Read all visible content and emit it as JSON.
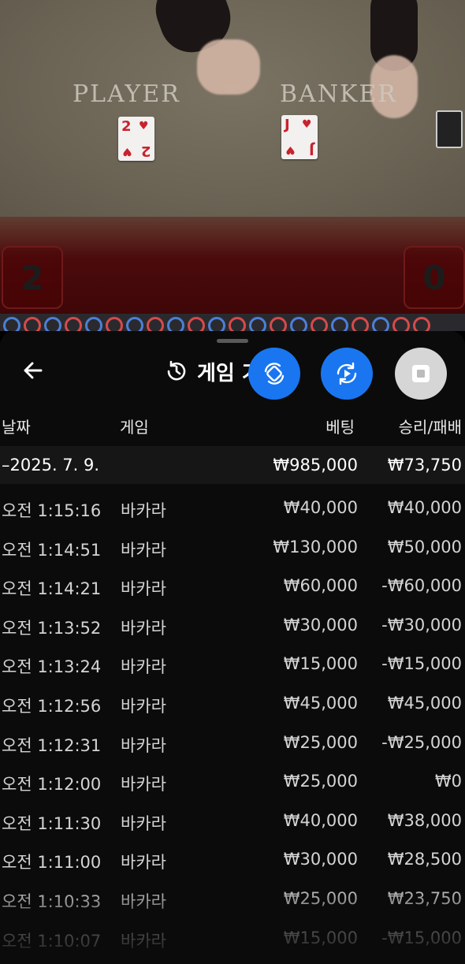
{
  "video": {
    "player_label": "PLAYER",
    "banker_label": "BANKER",
    "player_card": {
      "rank": "2",
      "suit": "♥"
    },
    "banker_card": {
      "rank": "J",
      "suit": "♥"
    },
    "player_score": "2",
    "banker_score": "0",
    "road": [
      "blue",
      "red",
      "blue",
      "red",
      "blue",
      "red",
      "blue",
      "red",
      "blue",
      "red",
      "blue",
      "red",
      "blue",
      "red",
      "blue",
      "red",
      "blue",
      "red",
      "blue",
      "red",
      "red"
    ]
  },
  "header": {
    "back_icon": "arrow-left-icon",
    "history_icon": "history-icon",
    "title": "게임 기록",
    "fab_swap_icon": "swap-icon",
    "fab_replay_icon": "replay-icon",
    "fab_stop_icon": "stop-icon",
    "accent": "#1976f0"
  },
  "columns": {
    "date": "날짜",
    "game": "게임",
    "bet": "베팅",
    "result": "승리/패배"
  },
  "summary": {
    "date": "–2025. 7. 9.",
    "bet": "₩985,000",
    "result": "₩73,750"
  },
  "rows": [
    {
      "time": "오전 1:15:16",
      "game": "바카라",
      "bet": "₩40,000",
      "result": "₩40,000"
    },
    {
      "time": "오전 1:14:51",
      "game": "바카라",
      "bet": "₩130,000",
      "result": "₩50,000"
    },
    {
      "time": "오전 1:14:21",
      "game": "바카라",
      "bet": "₩60,000",
      "result": "-₩60,000"
    },
    {
      "time": "오전 1:13:52",
      "game": "바카라",
      "bet": "₩30,000",
      "result": "-₩30,000"
    },
    {
      "time": "오전 1:13:24",
      "game": "바카라",
      "bet": "₩15,000",
      "result": "-₩15,000"
    },
    {
      "time": "오전 1:12:56",
      "game": "바카라",
      "bet": "₩45,000",
      "result": "₩45,000"
    },
    {
      "time": "오전 1:12:31",
      "game": "바카라",
      "bet": "₩25,000",
      "result": "-₩25,000"
    },
    {
      "time": "오전 1:12:00",
      "game": "바카라",
      "bet": "₩25,000",
      "result": "₩0"
    },
    {
      "time": "오전 1:11:30",
      "game": "바카라",
      "bet": "₩40,000",
      "result": "₩38,000"
    },
    {
      "time": "오전 1:11:00",
      "game": "바카라",
      "bet": "₩30,000",
      "result": "₩28,500"
    },
    {
      "time": "오전 1:10:33",
      "game": "바카라",
      "bet": "₩25,000",
      "result": "₩23,750"
    },
    {
      "time": "오전 1:10:07",
      "game": "바카라",
      "bet": "₩15,000",
      "result": "-₩15,000"
    }
  ]
}
